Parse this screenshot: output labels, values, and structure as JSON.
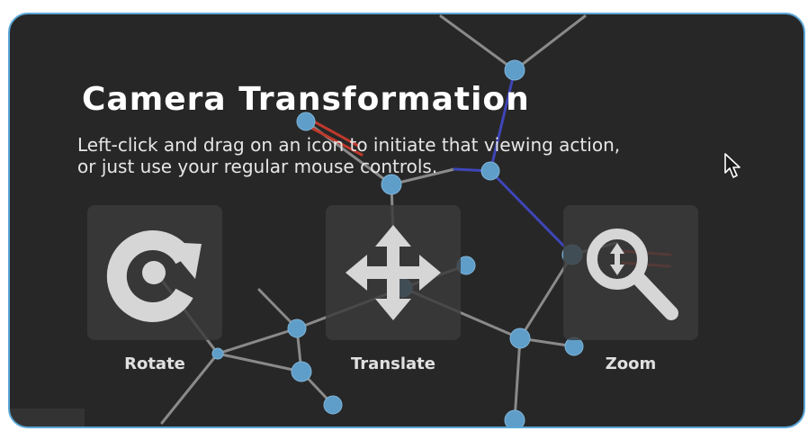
{
  "panel": {
    "title": "Camera Transformation",
    "description_line1": "Left-click and drag on an icon to initiate that viewing action,",
    "description_line2": "or just use your regular mouse controls."
  },
  "tools": [
    {
      "label": "Rotate",
      "icon": "rotate-icon"
    },
    {
      "label": "Translate",
      "icon": "move-arrows-icon"
    },
    {
      "label": "Zoom",
      "icon": "magnifier-zoom-icon"
    }
  ],
  "colors": {
    "panel_background": "#272727",
    "panel_border": "#5aa7d6",
    "atom": "#5f9ec9",
    "bond": "#8a8a8a",
    "bond_red": "#c0392b",
    "bond_blue": "#3f45b8",
    "icon_glyph": "#d6d6d6"
  }
}
